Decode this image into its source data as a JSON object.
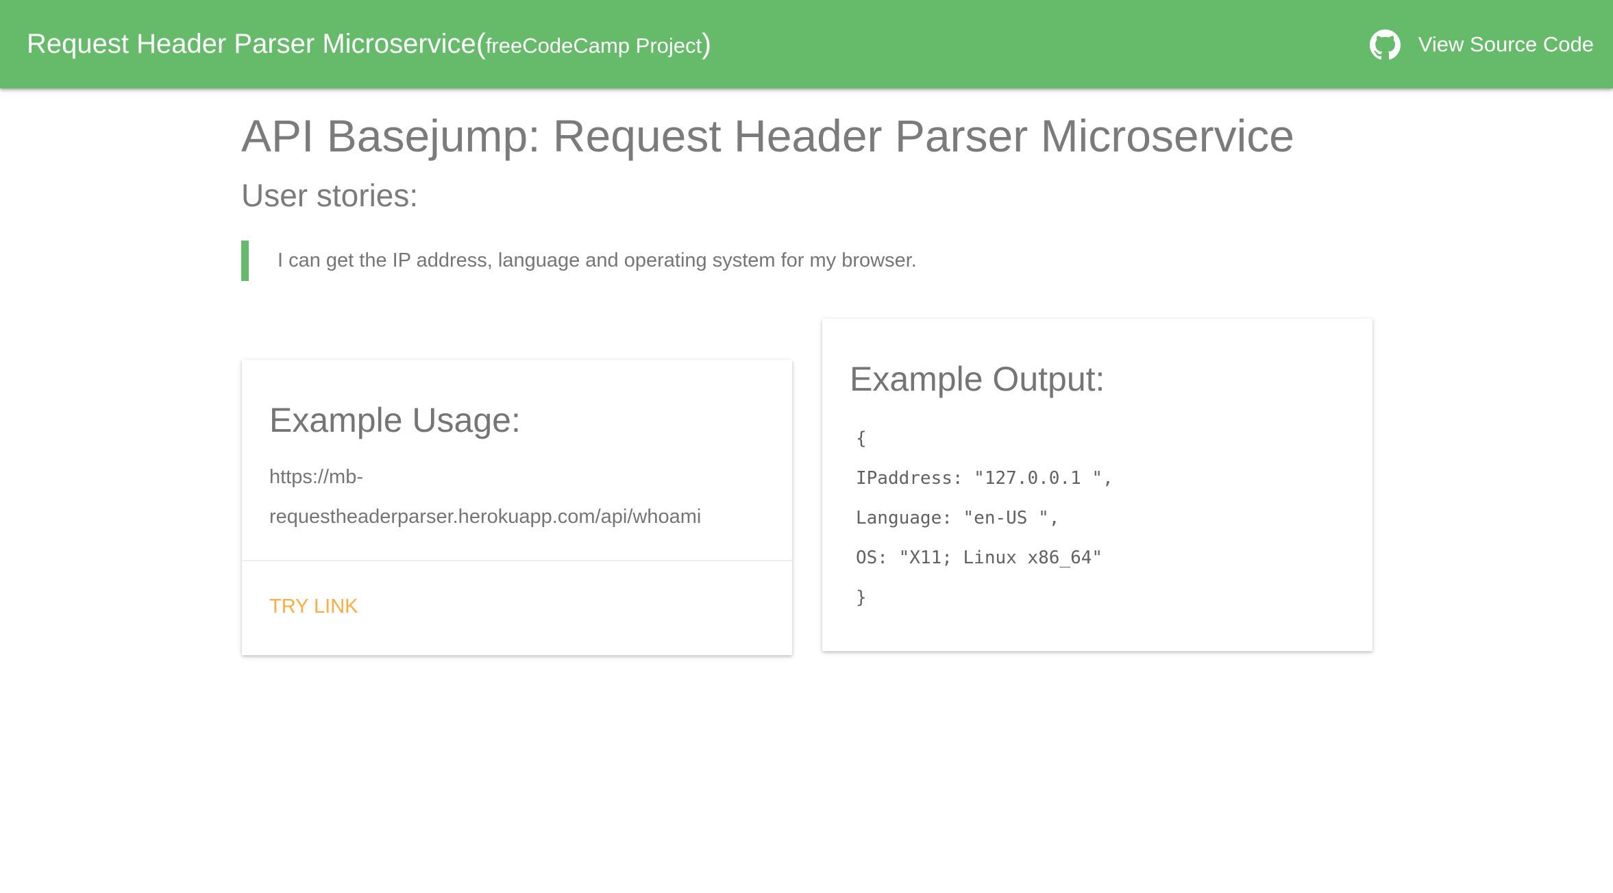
{
  "navbar": {
    "brand_main": "Request Header Parser Microservice",
    "brand_open_paren": "(",
    "brand_sub": "freeCodeCamp Project",
    "brand_close_paren": ")",
    "source_label": "View Source Code",
    "source_icon": "github-icon",
    "color": "#66bb6a"
  },
  "main": {
    "title": "API Basejump: Request Header Parser Microservice",
    "stories_heading": "User stories:",
    "stories": [
      "I can get the IP address, language and operating system for my browser."
    ]
  },
  "usage_card": {
    "title": "Example Usage:",
    "url_lines": [
      "https://mb-",
      "requestheaderparser.herokuapp.com/api/whoami"
    ],
    "action_label": "TRY LINK",
    "action_color": "#ffab40"
  },
  "output_card": {
    "title": "Example Output:",
    "lines": [
      "{",
      "IPaddress: \"127.0.0.1 \",",
      "Language: \"en-US \",",
      "OS: \"X11; Linux x86_64\"",
      "}"
    ]
  }
}
